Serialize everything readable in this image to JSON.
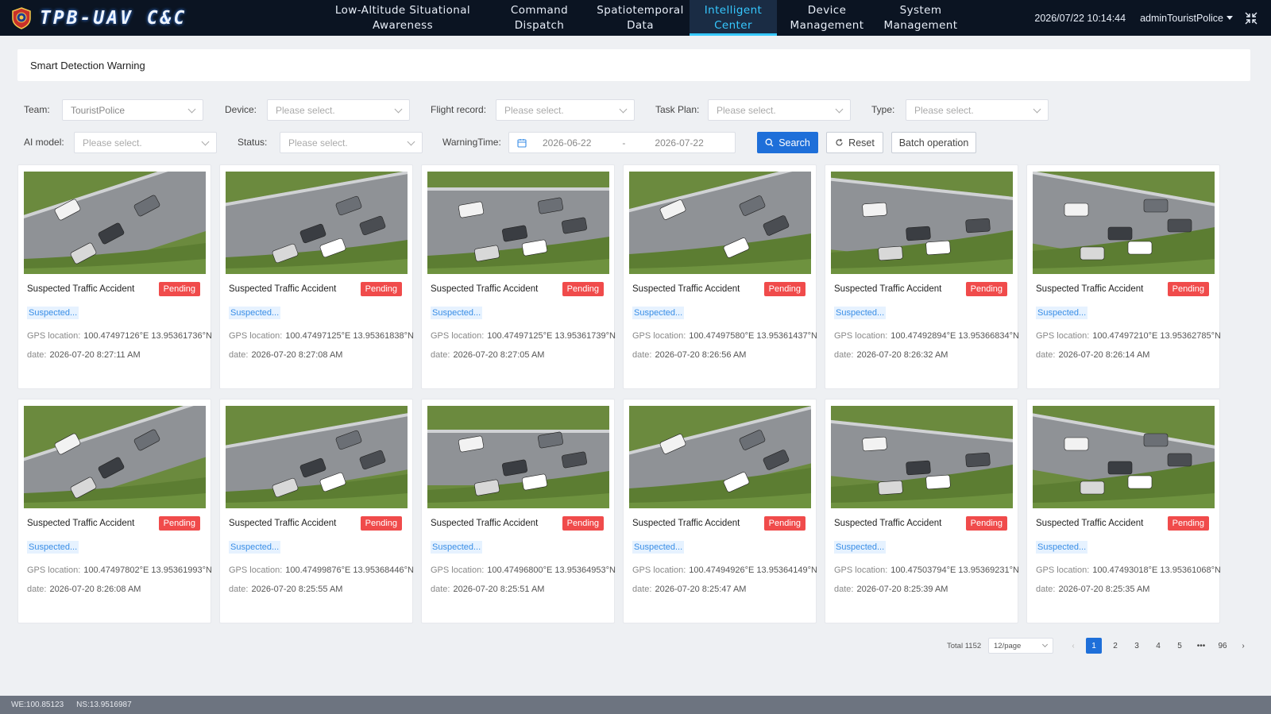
{
  "app": {
    "title": "TPB-UAV C&C"
  },
  "nav": {
    "items": [
      {
        "label_line1": "Low-Altitude Situational",
        "label_line2": "Awareness"
      },
      {
        "label_line1": "Command",
        "label_line2": "Dispatch"
      },
      {
        "label_line1": "Spatiotemporal",
        "label_line2": "Data"
      },
      {
        "label_line1": "Intelligent",
        "label_line2": "Center"
      },
      {
        "label_line1": "Device",
        "label_line2": "Management"
      },
      {
        "label_line1": "System",
        "label_line2": "Management"
      }
    ],
    "active_index": 3
  },
  "header": {
    "datetime": "2026/07/22 10:14:44",
    "user": "adminTouristPolice"
  },
  "page": {
    "title": "Smart Detection Warning"
  },
  "filters": {
    "team_label": "Team:",
    "team_value": "TouristPolice",
    "device_label": "Device:",
    "device_placeholder": "Please select.",
    "flight_label": "Flight record:",
    "flight_placeholder": "Please select.",
    "task_label": "Task Plan:",
    "task_placeholder": "Please select.",
    "type_label": "Type:",
    "type_placeholder": "Please select.",
    "ai_label": "AI model:",
    "ai_placeholder": "Please select.",
    "status_label": "Status:",
    "status_placeholder": "Please select.",
    "warning_label": "WarningTime:",
    "date_start": "2026-06-22",
    "date_sep": "-",
    "date_end": "2026-07-22",
    "search_label": "Search",
    "reset_label": "Reset",
    "batch_label": "Batch operation"
  },
  "cards": [
    {
      "title": "Suspected Traffic Accident",
      "status": "Pending",
      "tag": "Suspected...",
      "gps_label": "GPS location:",
      "gps": "100.47497126°E 13.95361736°N",
      "date_label": "date:",
      "date": "2026-07-20 8:27:11 AM"
    },
    {
      "title": "Suspected Traffic Accident",
      "status": "Pending",
      "tag": "Suspected...",
      "gps_label": "GPS location:",
      "gps": "100.47497125°E 13.95361838°N",
      "date_label": "date:",
      "date": "2026-07-20 8:27:08 AM"
    },
    {
      "title": "Suspected Traffic Accident",
      "status": "Pending",
      "tag": "Suspected...",
      "gps_label": "GPS location:",
      "gps": "100.47497125°E 13.95361739°N",
      "date_label": "date:",
      "date": "2026-07-20 8:27:05 AM"
    },
    {
      "title": "Suspected Traffic Accident",
      "status": "Pending",
      "tag": "Suspected...",
      "gps_label": "GPS location:",
      "gps": "100.47497580°E 13.95361437°N",
      "date_label": "date:",
      "date": "2026-07-20 8:26:56 AM"
    },
    {
      "title": "Suspected Traffic Accident",
      "status": "Pending",
      "tag": "Suspected...",
      "gps_label": "GPS location:",
      "gps": "100.47492894°E 13.95366834°N",
      "date_label": "date:",
      "date": "2026-07-20 8:26:32 AM"
    },
    {
      "title": "Suspected Traffic Accident",
      "status": "Pending",
      "tag": "Suspected...",
      "gps_label": "GPS location:",
      "gps": "100.47497210°E 13.95362785°N",
      "date_label": "date:",
      "date": "2026-07-20 8:26:14 AM"
    },
    {
      "title": "Suspected Traffic Accident",
      "status": "Pending",
      "tag": "Suspected...",
      "gps_label": "GPS location:",
      "gps": "100.47497802°E 13.95361993°N",
      "date_label": "date:",
      "date": "2026-07-20 8:26:08 AM"
    },
    {
      "title": "Suspected Traffic Accident",
      "status": "Pending",
      "tag": "Suspected...",
      "gps_label": "GPS location:",
      "gps": "100.47499876°E 13.95368446°N",
      "date_label": "date:",
      "date": "2026-07-20 8:25:55 AM"
    },
    {
      "title": "Suspected Traffic Accident",
      "status": "Pending",
      "tag": "Suspected...",
      "gps_label": "GPS location:",
      "gps": "100.47496800°E 13.95364953°N",
      "date_label": "date:",
      "date": "2026-07-20 8:25:51 AM"
    },
    {
      "title": "Suspected Traffic Accident",
      "status": "Pending",
      "tag": "Suspected...",
      "gps_label": "GPS location:",
      "gps": "100.47494926°E 13.95364149°N",
      "date_label": "date:",
      "date": "2026-07-20 8:25:47 AM"
    },
    {
      "title": "Suspected Traffic Accident",
      "status": "Pending",
      "tag": "Suspected...",
      "gps_label": "GPS location:",
      "gps": "100.47503794°E 13.95369231°N",
      "date_label": "date:",
      "date": "2026-07-20 8:25:39 AM"
    },
    {
      "title": "Suspected Traffic Accident",
      "status": "Pending",
      "tag": "Suspected...",
      "gps_label": "GPS location:",
      "gps": "100.47493018°E 13.95361068°N",
      "date_label": "date:",
      "date": "2026-07-20 8:25:35 AM"
    }
  ],
  "pagination": {
    "total": "Total 1152",
    "page_size": "12/page",
    "pages": [
      "1",
      "2",
      "3",
      "4",
      "5",
      "•••",
      "96"
    ],
    "active_page": "1",
    "prev_icon": "‹",
    "next_icon": "›"
  },
  "footer": {
    "we": "WE:100.85123",
    "ns": "NS:13.9516987"
  },
  "colors": {
    "accent": "#1e6fd9",
    "nav_active": "#36c8ff",
    "pending": "#f04b4b",
    "topbar": "#0b1422"
  },
  "icons": {
    "logo": "shield-badge-icon",
    "user_menu": "caret-down-icon",
    "fullscreen": "collapse-arrows-icon",
    "calendar": "calendar-icon",
    "search": "search-icon",
    "reset": "refresh-icon"
  }
}
